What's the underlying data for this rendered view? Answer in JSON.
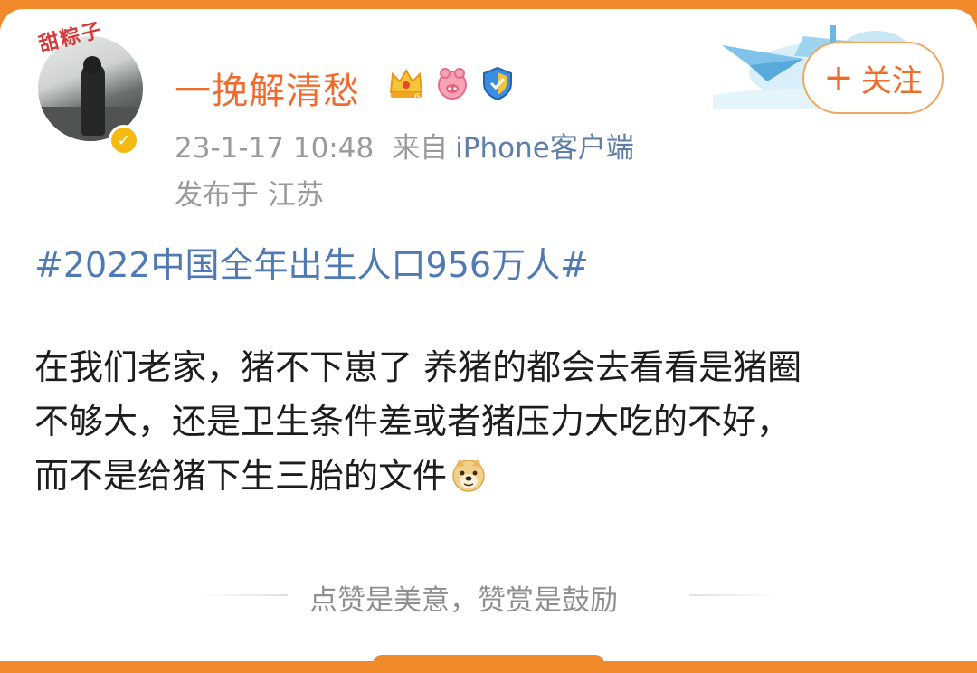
{
  "post": {
    "author": {
      "name": "一挽解清愁",
      "avatar_icon": "avatar-icon",
      "avatar_deco_text": "甜粽子",
      "verified_icon": "verified-check-icon",
      "badges": [
        "crown-vip-icon",
        "pig-badge-icon",
        "shield-badge-icon"
      ],
      "crown_level": "6"
    },
    "meta": {
      "time": "23-1-17 10:48",
      "from_label": "来自",
      "client": "iPhone客户端",
      "location_label": "发布于",
      "location": "江苏"
    },
    "follow_button": {
      "icon": "plus-icon",
      "label": "关注"
    },
    "hashtag": "#2022中国全年出生人口956万人#",
    "content_lines": [
      "在我们老家，猪不下崽了 养猪的都会去看看是猪圈",
      "不够大，还是卫生条件差或者猪压力大吃的不好，",
      "而不是给猪下生三胎的文件"
    ],
    "content_emoji": "doge-emoji-icon",
    "footer_text": "点赞是美意，赞赏是鼓励"
  },
  "colors": {
    "accent": "#f06b2c",
    "link": "#4f7ab3",
    "meta": "#9a9a9a",
    "top_bar": "#f08a2a"
  }
}
